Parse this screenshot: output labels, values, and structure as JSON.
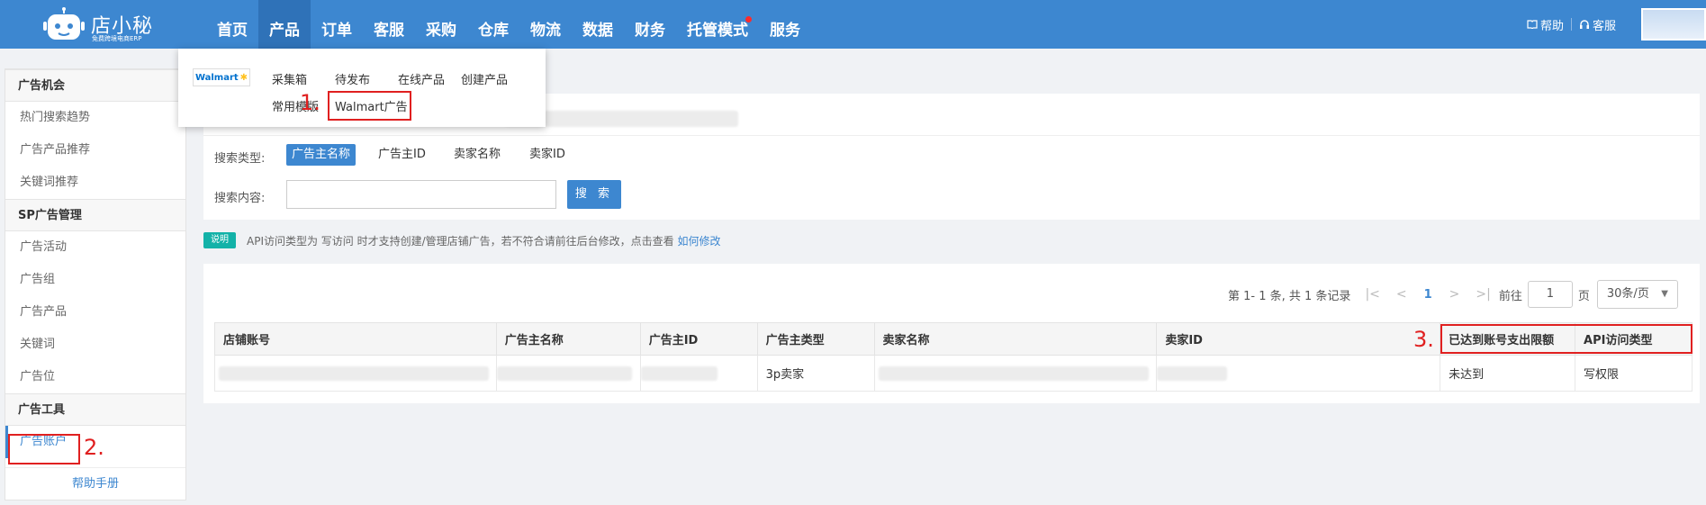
{
  "brand": {
    "name": "店小秘",
    "subtitle": "免费跨境电商ERP"
  },
  "nav": [
    "首页",
    "产品",
    "订单",
    "客服",
    "采购",
    "仓库",
    "物流",
    "数据",
    "财务",
    "托管模式",
    "服务"
  ],
  "nav_active": "产品",
  "top_right": {
    "help": "帮助",
    "service": "客服"
  },
  "dropdown": {
    "platform": "Walmart",
    "row1": [
      "采集箱",
      "待发布",
      "在线产品",
      "创建产品"
    ],
    "row2": [
      "常用模版",
      "Walmart广告"
    ]
  },
  "sidebar": {
    "groups": [
      {
        "title": "广告机会",
        "items": [
          "热门搜索趋势",
          "广告产品推荐",
          "关键词推荐"
        ]
      },
      {
        "title": "SP广告管理",
        "items": [
          "广告活动",
          "广告组",
          "广告产品",
          "关键词",
          "广告位"
        ]
      },
      {
        "title": "广告工具",
        "items": [
          "广告账户"
        ]
      }
    ],
    "active_item": "广告账户",
    "help": "帮助手册"
  },
  "steps": {
    "one": "1.",
    "two": "2.",
    "three": "3."
  },
  "search": {
    "type_label": "搜索类型:",
    "types": [
      "广告主名称",
      "广告主ID",
      "卖家名称",
      "卖家ID"
    ],
    "content_label": "搜索内容:",
    "button": "搜 索"
  },
  "notice": {
    "tag": "说明",
    "text": "API访问类型为 写访问 时才支持创建/管理店铺广告，若不符合请前往后台修改，点击查看",
    "link": "如何修改"
  },
  "pager": {
    "summary": "第 1- 1 条, 共 1 条记录",
    "current": "1",
    "goto_label": "前往",
    "goto_value": "1",
    "page_unit": "页",
    "page_size": "30条/页"
  },
  "table": {
    "headers": [
      "店铺账号",
      "广告主名称",
      "广告主ID",
      "广告主类型",
      "卖家名称",
      "卖家ID",
      "已达到账号支出限额",
      "API访问类型"
    ],
    "rows": [
      {
        "advertiser_type": "3p卖家",
        "limit_status": "未达到",
        "api_type": "写权限"
      }
    ]
  },
  "colors": {
    "primary": "#3d87d0",
    "highlight": "#e02020",
    "success": "#1aa44b",
    "tag": "#13b2a8"
  }
}
